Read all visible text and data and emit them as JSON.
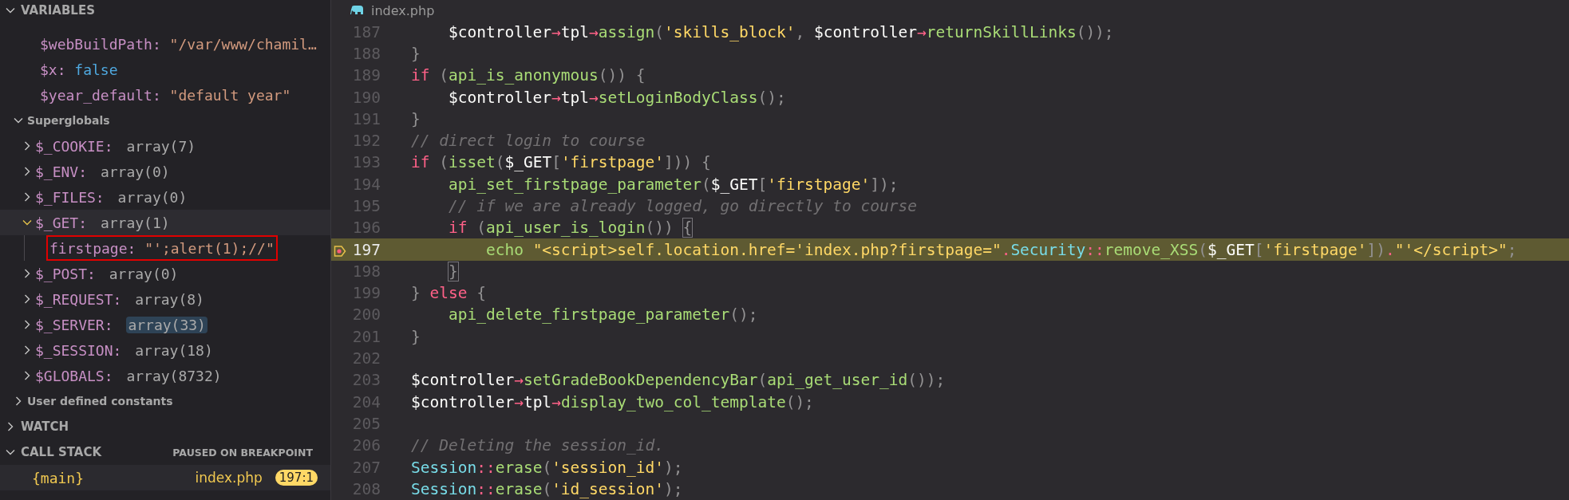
{
  "variables": {
    "title": "VARIABLES",
    "expanded": true,
    "items": [
      {
        "name": "$webBuildPath:",
        "value": "\"/var/www/chamil…",
        "kind": "string"
      },
      {
        "name": "$x:",
        "value": "false",
        "kind": "bool"
      },
      {
        "name": "$year_default:",
        "value": "\"default year\"",
        "kind": "string"
      }
    ],
    "scopes": [
      {
        "label": "Superglobals",
        "expanded": true,
        "items": [
          {
            "name": "$_COOKIE:",
            "value": "array(7)",
            "expanded": false,
            "selected": false,
            "highlighted": false
          },
          {
            "name": "$_ENV:",
            "value": "array(0)",
            "expanded": false,
            "selected": false,
            "highlighted": false
          },
          {
            "name": "$_FILES:",
            "value": "array(0)",
            "expanded": false,
            "selected": false,
            "highlighted": false
          },
          {
            "name": "$_GET:",
            "value": "array(1)",
            "expanded": true,
            "selected": true,
            "highlighted": false,
            "children": [
              {
                "name": "firstpage:",
                "value": "\"';alert(1);//\"",
                "boxed": true
              }
            ]
          },
          {
            "name": "$_POST:",
            "value": "array(0)",
            "expanded": false,
            "selected": false,
            "highlighted": false
          },
          {
            "name": "$_REQUEST:",
            "value": "array(8)",
            "expanded": false,
            "selected": false,
            "highlighted": false
          },
          {
            "name": "$_SERVER:",
            "value": "array(33)",
            "expanded": false,
            "selected": false,
            "highlighted": true
          },
          {
            "name": "$_SESSION:",
            "value": "array(18)",
            "expanded": false,
            "selected": false,
            "highlighted": false
          },
          {
            "name": "$GLOBALS:",
            "value": "array(8732)",
            "expanded": false,
            "selected": false,
            "highlighted": false
          }
        ]
      },
      {
        "label": "User defined constants",
        "expanded": false
      }
    ]
  },
  "watch": {
    "title": "WATCH",
    "expanded": false
  },
  "call_stack": {
    "title": "CALL STACK",
    "expanded": true,
    "status": "PAUSED ON BREAKPOINT",
    "frames": [
      {
        "name": "{main}",
        "file": "index.php",
        "position": "197:1"
      }
    ]
  },
  "editor": {
    "tab": {
      "label": "index.php"
    },
    "lines": [
      {
        "number": "187",
        "current": false,
        "tokens": [
          {
            "kind": "plain",
            "text": "    $controller"
          },
          {
            "kind": "op",
            "text": "→"
          },
          {
            "kind": "plain",
            "text": "tpl"
          },
          {
            "kind": "op",
            "text": "→"
          },
          {
            "kind": "fn",
            "text": "assign"
          },
          {
            "kind": "punc",
            "text": "("
          },
          {
            "kind": "str",
            "text": "'skills_block'"
          },
          {
            "kind": "punc",
            "text": ", "
          },
          {
            "kind": "plain",
            "text": "$controller"
          },
          {
            "kind": "op",
            "text": "→"
          },
          {
            "kind": "fn",
            "text": "returnSkillLinks"
          },
          {
            "kind": "punc",
            "text": "());"
          }
        ]
      },
      {
        "number": "188",
        "current": false,
        "tokens": [
          {
            "kind": "punc",
            "text": "}"
          }
        ]
      },
      {
        "number": "189",
        "current": false,
        "tokens": [
          {
            "kind": "kw",
            "text": "if"
          },
          {
            "kind": "punc",
            "text": " ("
          },
          {
            "kind": "fn",
            "text": "api_is_anonymous"
          },
          {
            "kind": "punc",
            "text": "()) {"
          }
        ]
      },
      {
        "number": "190",
        "current": false,
        "tokens": [
          {
            "kind": "plain",
            "text": "    $controller"
          },
          {
            "kind": "op",
            "text": "→"
          },
          {
            "kind": "plain",
            "text": "tpl"
          },
          {
            "kind": "op",
            "text": "→"
          },
          {
            "kind": "fn",
            "text": "setLoginBodyClass"
          },
          {
            "kind": "punc",
            "text": "();"
          }
        ]
      },
      {
        "number": "191",
        "current": false,
        "tokens": [
          {
            "kind": "punc",
            "text": "}"
          }
        ]
      },
      {
        "number": "192",
        "current": false,
        "tokens": [
          {
            "kind": "cmt",
            "text": "// direct login to course"
          }
        ]
      },
      {
        "number": "193",
        "current": false,
        "tokens": [
          {
            "kind": "kw",
            "text": "if"
          },
          {
            "kind": "punc",
            "text": " ("
          },
          {
            "kind": "fn",
            "text": "isset"
          },
          {
            "kind": "punc",
            "text": "("
          },
          {
            "kind": "plain",
            "text": "$_GET"
          },
          {
            "kind": "punc",
            "text": "["
          },
          {
            "kind": "str",
            "text": "'firstpage'"
          },
          {
            "kind": "punc",
            "text": "])) {"
          }
        ]
      },
      {
        "number": "194",
        "current": false,
        "tokens": [
          {
            "kind": "fn",
            "text": "    api_set_firstpage_parameter"
          },
          {
            "kind": "punc",
            "text": "("
          },
          {
            "kind": "plain",
            "text": "$_GET"
          },
          {
            "kind": "punc",
            "text": "["
          },
          {
            "kind": "str",
            "text": "'firstpage'"
          },
          {
            "kind": "punc",
            "text": "]);"
          }
        ]
      },
      {
        "number": "195",
        "current": false,
        "tokens": [
          {
            "kind": "cmt",
            "text": "    // if we are already logged, go directly to course"
          }
        ]
      },
      {
        "number": "196",
        "current": false,
        "tokens": [
          {
            "kind": "kw",
            "text": "    if"
          },
          {
            "kind": "punc",
            "text": " ("
          },
          {
            "kind": "fn",
            "text": "api_user_is_login"
          },
          {
            "kind": "punc",
            "text": "()) "
          },
          {
            "kind": "brace",
            "text": "{"
          }
        ]
      },
      {
        "number": "197",
        "current": true,
        "tokens": [
          {
            "kind": "fn",
            "text": "        echo "
          },
          {
            "kind": "str",
            "text": "\"<script>self.location.href='index.php?firstpage=\""
          },
          {
            "kind": "op",
            "text": "."
          },
          {
            "kind": "cls",
            "text": "Security"
          },
          {
            "kind": "op",
            "text": "::"
          },
          {
            "kind": "fn",
            "text": "remove_XSS"
          },
          {
            "kind": "punc",
            "text": "("
          },
          {
            "kind": "plain",
            "text": "$_GET"
          },
          {
            "kind": "punc",
            "text": "["
          },
          {
            "kind": "str",
            "text": "'firstpage'"
          },
          {
            "kind": "punc",
            "text": "])"
          },
          {
            "kind": "op",
            "text": "."
          },
          {
            "kind": "str",
            "text": "\"'</script>\""
          },
          {
            "kind": "punc",
            "text": ";"
          }
        ]
      },
      {
        "number": "198",
        "current": false,
        "tokens": [
          {
            "kind": "brace",
            "text": "    }"
          }
        ]
      },
      {
        "number": "199",
        "current": false,
        "tokens": [
          {
            "kind": "punc",
            "text": "} "
          },
          {
            "kind": "kw",
            "text": "else"
          },
          {
            "kind": "punc",
            "text": " {"
          }
        ]
      },
      {
        "number": "200",
        "current": false,
        "tokens": [
          {
            "kind": "fn",
            "text": "    api_delete_firstpage_parameter"
          },
          {
            "kind": "punc",
            "text": "();"
          }
        ]
      },
      {
        "number": "201",
        "current": false,
        "tokens": [
          {
            "kind": "punc",
            "text": "}"
          }
        ]
      },
      {
        "number": "202",
        "current": false
      },
      {
        "number": "203",
        "current": false,
        "tokens": [
          {
            "kind": "plain",
            "text": "$controller"
          },
          {
            "kind": "op",
            "text": "→"
          },
          {
            "kind": "fn",
            "text": "setGradeBookDependencyBar"
          },
          {
            "kind": "punc",
            "text": "("
          },
          {
            "kind": "fn",
            "text": "api_get_user_id"
          },
          {
            "kind": "punc",
            "text": "());"
          }
        ]
      },
      {
        "number": "204",
        "current": false,
        "tokens": [
          {
            "kind": "plain",
            "text": "$controller"
          },
          {
            "kind": "op",
            "text": "→"
          },
          {
            "kind": "plain",
            "text": "tpl"
          },
          {
            "kind": "op",
            "text": "→"
          },
          {
            "kind": "fn",
            "text": "display_two_col_template"
          },
          {
            "kind": "punc",
            "text": "();"
          }
        ]
      },
      {
        "number": "205",
        "current": false
      },
      {
        "number": "206",
        "current": false,
        "tokens": [
          {
            "kind": "cmt",
            "text": "// Deleting the session_id."
          }
        ]
      },
      {
        "number": "207",
        "current": false,
        "tokens": [
          {
            "kind": "cls",
            "text": "Session"
          },
          {
            "kind": "op",
            "text": "::"
          },
          {
            "kind": "fn",
            "text": "erase"
          },
          {
            "kind": "punc",
            "text": "("
          },
          {
            "kind": "str",
            "text": "'session_id'"
          },
          {
            "kind": "punc",
            "text": ");"
          }
        ]
      },
      {
        "number": "208",
        "current": false,
        "tokens": [
          {
            "kind": "cls",
            "text": "Session"
          },
          {
            "kind": "op",
            "text": "::"
          },
          {
            "kind": "fn",
            "text": "erase"
          },
          {
            "kind": "punc",
            "text": "("
          },
          {
            "kind": "str",
            "text": "'id_session'"
          },
          {
            "kind": "punc",
            "text": ");"
          }
        ]
      }
    ]
  }
}
